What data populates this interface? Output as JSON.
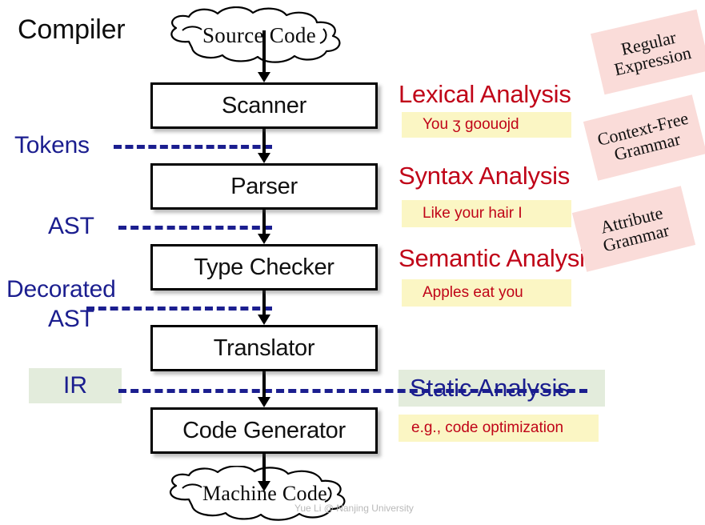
{
  "diagram": {
    "title": "Compiler",
    "watermark": "Yue Li @ Nanjing University"
  },
  "clouds": [
    {
      "id": "source",
      "label": "Source Code"
    },
    {
      "id": "machine",
      "label": "Machine Code"
    }
  ],
  "stages": [
    {
      "id": "scanner",
      "label": "Scanner"
    },
    {
      "id": "parser",
      "label": "Parser"
    },
    {
      "id": "type",
      "label": "Type Checker"
    },
    {
      "id": "translator",
      "label": "Translator"
    },
    {
      "id": "codegen",
      "label": "Code Generator"
    }
  ],
  "intermediates": {
    "tokens": "Tokens",
    "ast": "AST",
    "decorated_line1": "Decorated",
    "decorated_line2": "AST",
    "ir": "IR"
  },
  "analyses": [
    {
      "id": "lexical",
      "heading": "Lexical Analysis",
      "example": "You ʒ goouojd"
    },
    {
      "id": "syntax",
      "heading": "Syntax Analysis",
      "example": "Like your hair I"
    },
    {
      "id": "semantic",
      "heading": "Semantic Analysis",
      "example": "Apples eat you"
    }
  ],
  "static_analysis": {
    "heading": "Static Analysis",
    "example": "e.g., code optimization"
  },
  "formalisms": [
    {
      "id": "regex",
      "line1": "Regular",
      "line2": "Expression"
    },
    {
      "id": "cfg",
      "line1": "Context-Free",
      "line2": "Grammar"
    },
    {
      "id": "attr",
      "line1": "Attribute",
      "line2": "Grammar"
    }
  ],
  "colors": {
    "heading_red": "#C00418",
    "label_blue": "#1B1E8F",
    "tag_pink": "#FADCD9",
    "example_yellow": "#FBF6C4",
    "band_green": "#E3ECDC",
    "box_border": "#000000"
  }
}
